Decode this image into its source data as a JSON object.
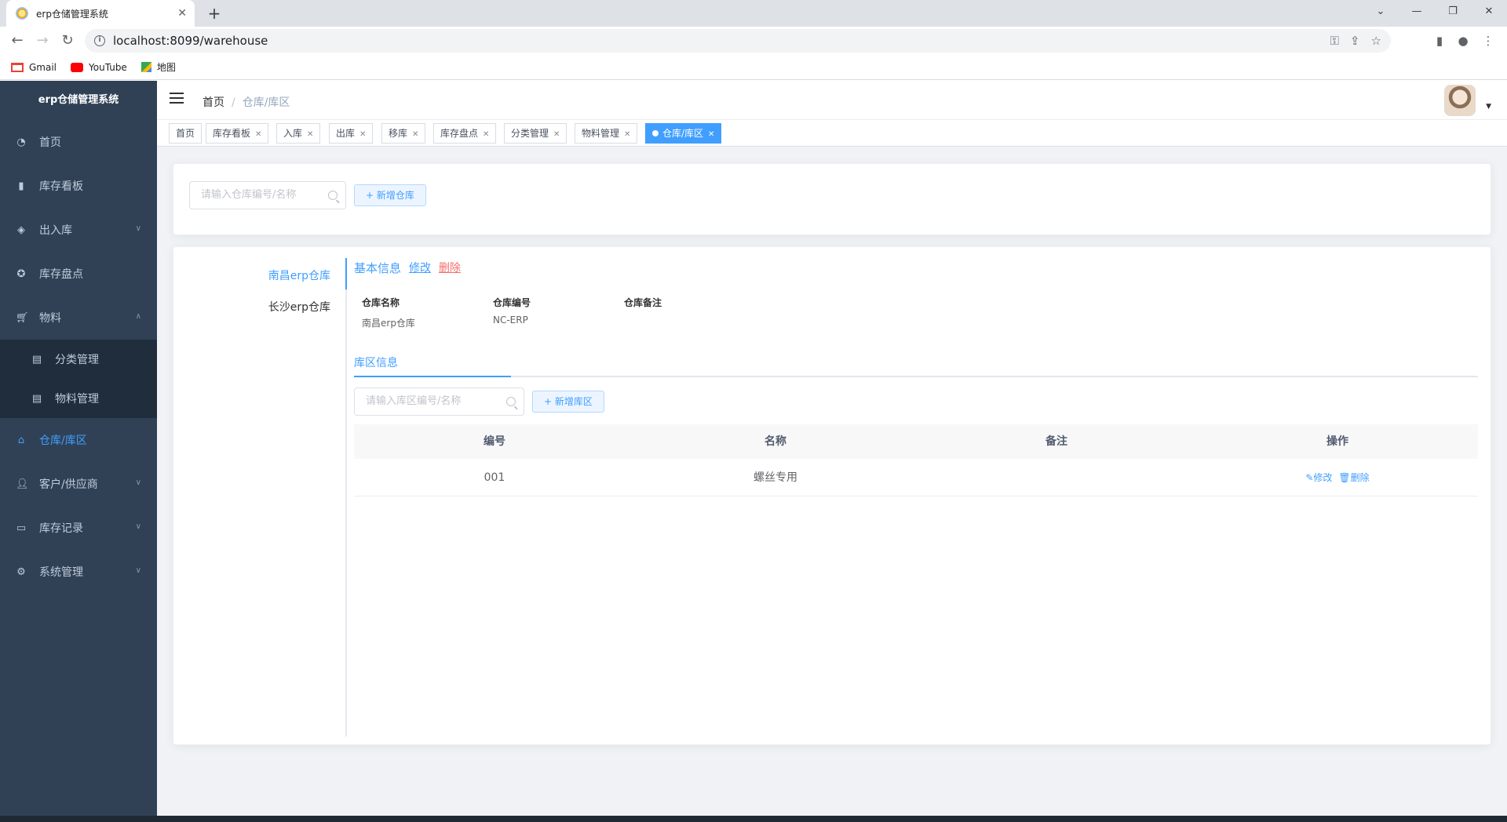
{
  "browser": {
    "tab_title": "erp仓储管理系统",
    "url": "localhost:8099/warehouse",
    "bookmarks": [
      "Gmail",
      "YouTube",
      "地图"
    ]
  },
  "sidebar": {
    "logo": "erp仓储管理系统",
    "items": [
      {
        "label": "首页",
        "icon": "dashboard-icon"
      },
      {
        "label": "库存看板",
        "icon": "bar-chart-icon"
      },
      {
        "label": "出入库",
        "icon": "layers-icon"
      },
      {
        "label": "库存盘点",
        "icon": "target-icon"
      },
      {
        "label": "物料",
        "icon": "cart-icon"
      },
      {
        "label": "分类管理",
        "icon": "doc-icon"
      },
      {
        "label": "物料管理",
        "icon": "doc-icon"
      },
      {
        "label": "仓库/库区",
        "icon": "warehouse-icon"
      },
      {
        "label": "客户/供应商",
        "icon": "user-icon"
      },
      {
        "label": "库存记录",
        "icon": "monitor-icon"
      },
      {
        "label": "系统管理",
        "icon": "gear-icon"
      }
    ]
  },
  "navbar": {
    "breadcrumb": [
      "首页",
      "仓库/库区"
    ]
  },
  "tags": [
    "首页",
    "库存看板",
    "入库",
    "出库",
    "移库",
    "库存盘点",
    "分类管理",
    "物料管理",
    "仓库/库区"
  ],
  "search": {
    "warehouse_placeholder": "请输入仓库编号/名称",
    "add_warehouse": "+ 新增仓库"
  },
  "warehouses": [
    "南昌erp仓库",
    "长沙erp仓库"
  ],
  "detail": {
    "title": "基本信息",
    "edit": "修改",
    "delete": "删除",
    "labels": [
      "仓库名称",
      "仓库编号",
      "仓库备注"
    ],
    "values": [
      "南昌erp仓库",
      "NC-ERP",
      ""
    ]
  },
  "zone": {
    "tab": "库区信息",
    "placeholder": "请输入库区编号/名称",
    "add": "+ 新增库区",
    "columns": [
      "编号",
      "名称",
      "备注",
      "操作"
    ],
    "rows": [
      {
        "code": "001",
        "name": "螺丝专用",
        "remark": "",
        "edit": "修改",
        "delete": "删除"
      }
    ]
  }
}
